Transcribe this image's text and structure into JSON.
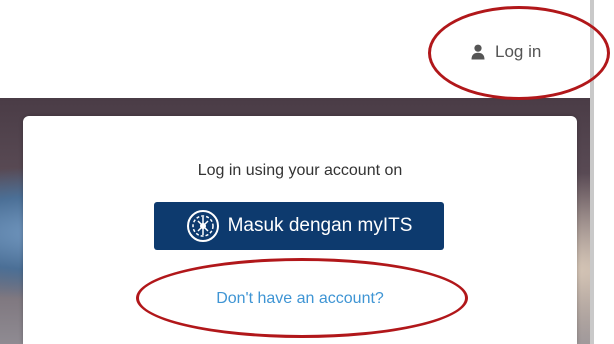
{
  "header": {
    "login_label": "Log in",
    "login_icon": "user-icon"
  },
  "login_card": {
    "title": "Log in using your account on",
    "provider_button_label": "Masuk dengan myITS",
    "provider_icon": "its-logo",
    "signup_link": "Don't have an account?"
  },
  "colors": {
    "button_bg": "#0d3a6e",
    "link": "#3f95d4",
    "annotation": "#b1171a"
  }
}
